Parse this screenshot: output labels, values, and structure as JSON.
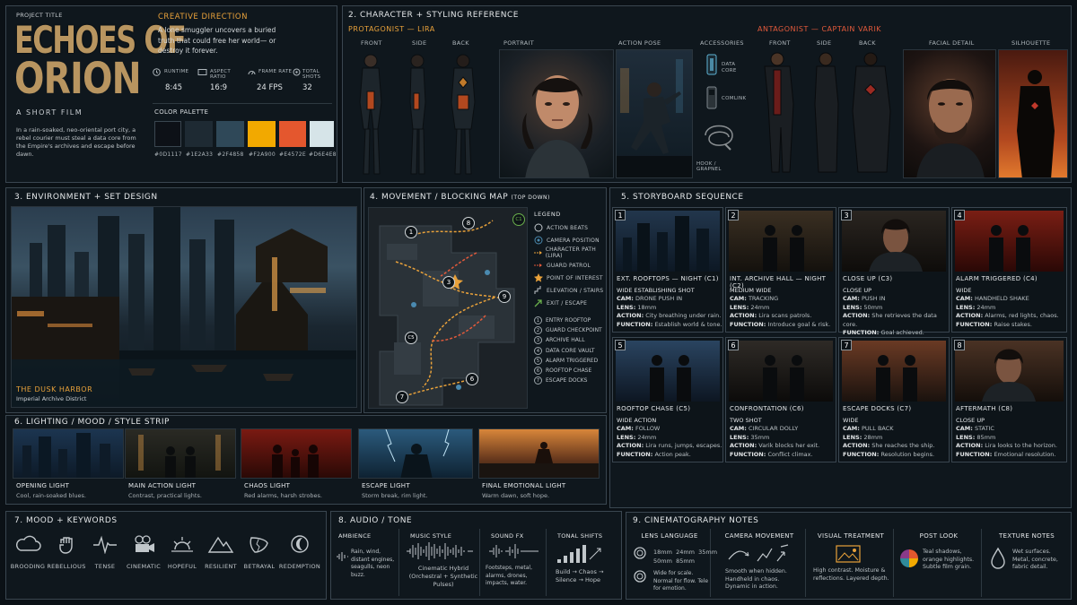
{
  "header": {
    "project_label": "PROJECT TITLE",
    "title_line1": "ECHOES OF",
    "title_line2": "ORION",
    "subtitle": "A SHORT FILM",
    "logline": "In a rain-soaked, neo-oriental port city, a rebel courier must steal a data core from the Empire's archives and escape before dawn."
  },
  "creative": {
    "heading": "CREATIVE DIRECTION",
    "text": "A lone smuggler uncovers a buried truth that could free her world— or destroy it forever.",
    "stats": [
      {
        "label": "RUNTIME",
        "value": "8:45",
        "icon": "clock-icon"
      },
      {
        "label": "ASPECT RATIO",
        "value": "16:9",
        "icon": "aspect-ratio-icon"
      },
      {
        "label": "FRAME RATE",
        "value": "24 FPS",
        "icon": "speedometer-icon"
      },
      {
        "label": "TOTAL SHOTS",
        "value": "32",
        "icon": "shots-icon"
      }
    ],
    "palette_heading": "COLOR PALETTE",
    "palette": [
      {
        "hex": "#0D1117",
        "label": "#0D1117"
      },
      {
        "hex": "#1E2A33",
        "label": "#1E2A33"
      },
      {
        "hex": "#2F4858",
        "label": "#2F4858"
      },
      {
        "hex": "#F2A900",
        "label": "#F2A900"
      },
      {
        "hex": "#E4572E",
        "label": "#E4572E"
      },
      {
        "hex": "#D6E4E8",
        "label": "#D6E4E8"
      }
    ]
  },
  "character": {
    "heading": "2. CHARACTER + STYLING REFERENCE",
    "protagonist": "PROTAGONIST — LIRA",
    "antagonist": "ANTAGONIST — CAPTAIN VARIK",
    "views": {
      "front": "FRONT",
      "side": "SIDE",
      "back": "BACK",
      "portrait": "PORTRAIT",
      "action": "ACTION POSE",
      "accessories": "ACCESSORIES",
      "facial": "FACIAL DETAIL",
      "silhouette": "SILHOUETTE"
    },
    "accessories": [
      "DATA CORE",
      "COMLINK",
      "HOOK / GRAPNEL"
    ]
  },
  "environment": {
    "heading": "3. ENVIRONMENT + SET DESIGN",
    "location": "THE DUSK HARBOR",
    "sublocation": "Imperial Archive District"
  },
  "movement": {
    "heading": "4. MOVEMENT / BLOCKING MAP",
    "heading_note": "(TOP DOWN)",
    "legend_title": "LEGEND",
    "legend": [
      {
        "label": "ACTION BEATS",
        "icon": "action-beat-icon"
      },
      {
        "label": "CAMERA POSITION",
        "icon": "camera-position-icon"
      },
      {
        "label": "CHARACTER PATH (LIRA)",
        "icon": "character-path-icon"
      },
      {
        "label": "GUARD PATROL",
        "icon": "guard-patrol-icon"
      },
      {
        "label": "POINT OF INTEREST",
        "icon": "star-icon"
      },
      {
        "label": "ELEVATION / STAIRS",
        "icon": "stairs-icon"
      },
      {
        "label": "EXIT / ESCAPE",
        "icon": "exit-arrow-icon"
      }
    ],
    "beats": [
      {
        "n": "1",
        "label": "ENTRY ROOFTOP"
      },
      {
        "n": "2",
        "label": "GUARD CHECKPOINT"
      },
      {
        "n": "3",
        "label": "ARCHIVE HALL"
      },
      {
        "n": "4",
        "label": "DATA CORE VAULT"
      },
      {
        "n": "5",
        "label": "ALARM TRIGGERED"
      },
      {
        "n": "6",
        "label": "ROOFTOP CHASE"
      },
      {
        "n": "7",
        "label": "ESCAPE DOCKS"
      }
    ],
    "map_labels": [
      "1",
      "8",
      "C1",
      "3",
      "9",
      "C5",
      "6",
      "7"
    ]
  },
  "storyboard": {
    "heading": "5. STORYBOARD SEQUENCE",
    "panels": [
      {
        "n": "1",
        "title": "EXT. ROOFTOPS — NIGHT (C1)",
        "shot": "WIDE ESTABLISHING SHOT",
        "cam": "DRONE PUSH IN",
        "lens": "18mm",
        "action": "City breathing under rain.",
        "function": "Establish world & tone."
      },
      {
        "n": "2",
        "title": "INT. ARCHIVE HALL — NIGHT (C2)",
        "shot": "MEDIUM WIDE",
        "cam": "TRACKING",
        "lens": "24mm",
        "action": "Lira scans patrols.",
        "function": "Introduce goal & risk."
      },
      {
        "n": "3",
        "title": "CLOSE UP (C3)",
        "shot": "CLOSE UP",
        "cam": "PUSH IN",
        "lens": "50mm",
        "action": "She retrieves the data core.",
        "function": "Goal achieved."
      },
      {
        "n": "4",
        "title": "ALARM TRIGGERED (C4)",
        "shot": "WIDE",
        "cam": "HANDHELD SHAKE",
        "lens": "24mm",
        "action": "Alarms, red lights, chaos.",
        "function": "Raise stakes."
      },
      {
        "n": "5",
        "title": "ROOFTOP CHASE (C5)",
        "shot": "WIDE ACTION",
        "cam": "FOLLOW",
        "lens": "24mm",
        "action": "Lira runs, jumps, escapes.",
        "function": "Action peak."
      },
      {
        "n": "6",
        "title": "CONFRONTATION (C6)",
        "shot": "TWO SHOT",
        "cam": "CIRCULAR DOLLY",
        "lens": "35mm",
        "action": "Varik blocks her exit.",
        "function": "Conflict climax."
      },
      {
        "n": "7",
        "title": "ESCAPE DOCKS (C7)",
        "shot": "WIDE",
        "cam": "PULL BACK",
        "lens": "28mm",
        "action": "She reaches the ship.",
        "function": "Resolution begins."
      },
      {
        "n": "8",
        "title": "AFTERMATH (C8)",
        "shot": "CLOSE UP",
        "cam": "STATIC",
        "lens": "85mm",
        "action": "Lira looks to the horizon.",
        "function": "Emotional resolution."
      }
    ],
    "labels": {
      "cam": "CAM:",
      "lens": "LENS:",
      "action": "ACTION:",
      "function": "FUNCTION:"
    }
  },
  "lighting": {
    "heading": "6. LIGHTING / MOOD / STYLE STRIP",
    "items": [
      {
        "title": "OPENING LIGHT",
        "desc": "Cool, rain-soaked blues."
      },
      {
        "title": "MAIN ACTION LIGHT",
        "desc": "Contrast, practical lights."
      },
      {
        "title": "CHAOS LIGHT",
        "desc": "Red alarms, harsh strobes."
      },
      {
        "title": "ESCAPE LIGHT",
        "desc": "Storm break, rim light."
      },
      {
        "title": "FINAL EMOTIONAL LIGHT",
        "desc": "Warm dawn, soft hope."
      }
    ]
  },
  "mood": {
    "heading": "7. MOOD + KEYWORDS",
    "keywords": [
      {
        "label": "BROODING",
        "icon": "cloud-icon"
      },
      {
        "label": "REBELLIOUS",
        "icon": "fist-icon"
      },
      {
        "label": "TENSE",
        "icon": "pulse-icon"
      },
      {
        "label": "CINEMATIC",
        "icon": "movie-camera-icon"
      },
      {
        "label": "HOPEFUL",
        "icon": "sunrise-icon"
      },
      {
        "label": "RESILIENT",
        "icon": "mountain-icon"
      },
      {
        "label": "BETRAYAL",
        "icon": "broken-mask-icon"
      },
      {
        "label": "REDEMPTION",
        "icon": "crescent-icon"
      }
    ]
  },
  "audio": {
    "heading": "8. AUDIO / TONE",
    "cols": [
      {
        "title": "AMBIENCE",
        "text": "Rain, wind, distant engines, seagulls, neon buzz."
      },
      {
        "title": "MUSIC STYLE",
        "text": "Cinematic Hybrid (Orchestral + Synthetic Pulses)"
      },
      {
        "title": "SOUND FX",
        "text": "Footsteps, metal, alarms, drones, impacts, water."
      },
      {
        "title": "TONAL SHIFTS",
        "text": "Build → Chaos → Silence → Hope"
      }
    ]
  },
  "cinematography": {
    "heading": "9. CINEMATOGRAPHY NOTES",
    "lens": {
      "title": "LENS LANGUAGE",
      "row1": "18mm  24mm  35mm",
      "row2": "50mm  85mm",
      "notes": "Wide for scale. Normal for flow. Tele for emotion."
    },
    "camera": {
      "title": "CAMERA MOVEMENT",
      "notes": "Smooth when hidden. Handheld in chaos. Dynamic in action."
    },
    "visual": {
      "title": "VISUAL TREATMENT",
      "notes": "High contrast. Moisture & reflections. Layered depth."
    },
    "post": {
      "title": "POST LOOK",
      "notes": "Teal shadows, orange highlights. Subtle film grain."
    },
    "texture": {
      "title": "TEXTURE NOTES",
      "notes": "Wet surfaces. Metal, concrete, fabric detail."
    }
  },
  "colors": {
    "accent": "#e8a13a",
    "red": "#e35a3b",
    "bg": "#0b1116",
    "panel": "#0f171d",
    "border": "#3a4650"
  }
}
